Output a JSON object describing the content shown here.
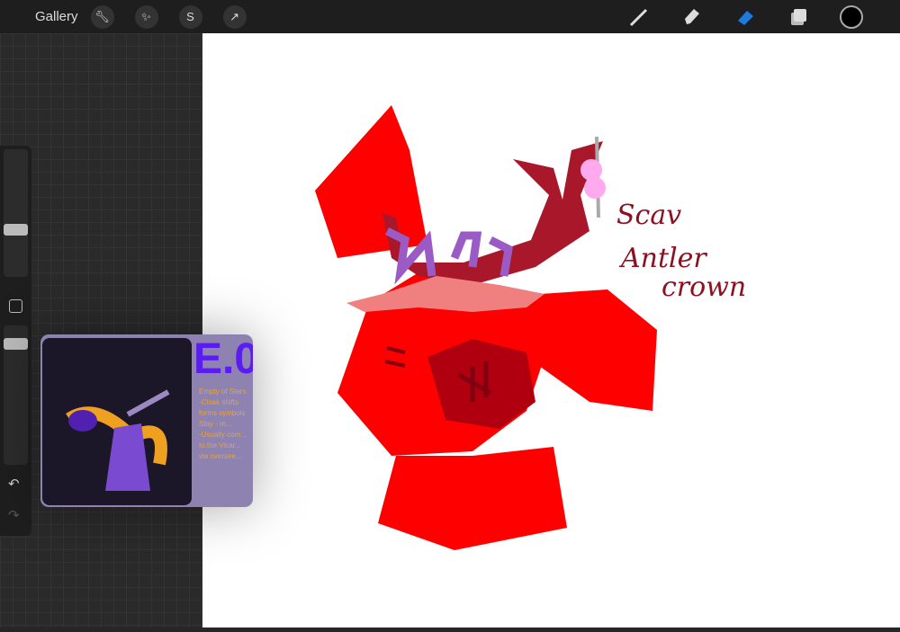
{
  "topbar": {
    "gallery_label": "Gallery",
    "tools_left": [
      "wrench-icon",
      "magic-wand-icon",
      "selection-icon",
      "transform-arrow-icon"
    ],
    "tools_right": [
      "brush-icon",
      "smudge-icon",
      "eraser-icon",
      "layers-icon"
    ],
    "active_tool": "eraser",
    "current_color": "#000000",
    "accent": "#1f7ae0"
  },
  "sidebar": {
    "brush_size_level": 0.45,
    "opacity_level": 0.9
  },
  "reference": {
    "title_lettering": "E.0",
    "notes": "Empty of Stars\n-Cloak shifts\nforms symbols\nStay - m...\n-Usually com...\nto the Vicar...\nvia oversee..."
  },
  "artwork": {
    "lettering": [
      "Scav",
      "Antler",
      "crown"
    ]
  }
}
